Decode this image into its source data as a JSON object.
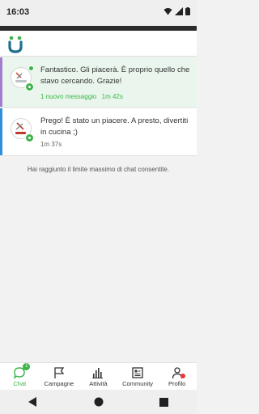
{
  "status_bar": {
    "time": "16:03"
  },
  "chats": [
    {
      "message": "Fantastico. Gli piacerà. È proprio quello che stavo cercando. Grazie!",
      "new_label": "1 nuovo messaggio",
      "time": "1m 42s",
      "accent_color": "#a37ed0"
    },
    {
      "message": "Prego! È stato un piacere. A presto, divertiti in cucina ;)",
      "time": "1m 37s",
      "accent_color": "#2f8fdc"
    }
  ],
  "limit_note": "Hai raggiunto il limite massimo di chat consentite.",
  "bottom_nav": {
    "items": [
      {
        "label": "Chat",
        "icon": "chat-bubble-icon",
        "badge": "1"
      },
      {
        "label": "Campagne",
        "icon": "flag-icon"
      },
      {
        "label": "Attività",
        "icon": "activity-bars-icon"
      },
      {
        "label": "Community",
        "icon": "community-board-icon"
      },
      {
        "label": "Profilo",
        "icon": "profile-person-icon"
      }
    ]
  },
  "colors": {
    "accent_green": "#3cb44b",
    "alert_red": "#e53935"
  }
}
